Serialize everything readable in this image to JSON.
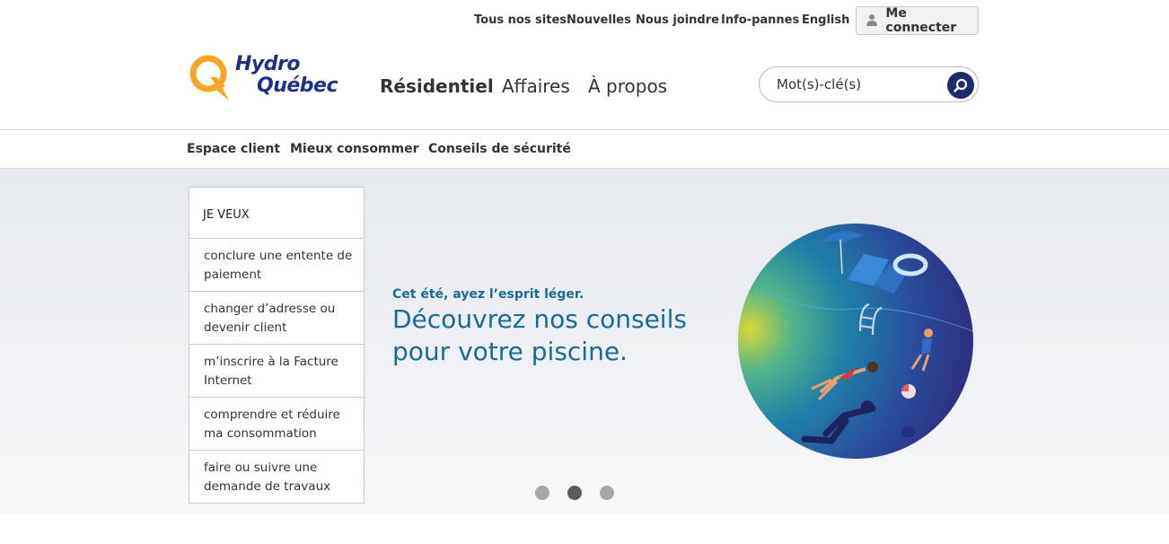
{
  "utility_nav": {
    "items": [
      "Tous nos sites",
      "Nouvelles",
      "Nous joindre",
      "Info-pannes",
      "English"
    ],
    "login_label": "Me connecter",
    "login_icon": "user-icon"
  },
  "logo": {
    "line1": "Hydro",
    "line2": "Québec",
    "colors": {
      "q": "#f5a623",
      "text": "#1f2e8c"
    }
  },
  "main_nav": {
    "items": [
      "Résidentiel",
      "Affaires",
      "À propos"
    ],
    "active": "Résidentiel"
  },
  "search": {
    "placeholder": "Mot(s)-clé(s)",
    "icon": "search-icon"
  },
  "sub_nav": {
    "items": [
      "Espace client",
      "Mieux consommer",
      "Conseils de sécurité"
    ]
  },
  "quick_menu": {
    "heading": "JE VEUX",
    "items": [
      "conclure une entente de paiement",
      "changer d’adresse ou devenir client",
      "m’inscrire à la Facture Internet",
      "comprendre et réduire ma consommation",
      "faire ou suivre une demande de travaux"
    ]
  },
  "hero": {
    "kicker": "Cet été, ayez l’esprit léger.",
    "title": "Découvrez nos conseils pour votre piscine.",
    "illustration": "pool-illustration",
    "carousel": {
      "count": 3,
      "active_index": 1
    }
  },
  "colors": {
    "brand_blue": "#1c2c6f",
    "accent_text": "#1a6a94",
    "logo_orange": "#f5a623"
  }
}
